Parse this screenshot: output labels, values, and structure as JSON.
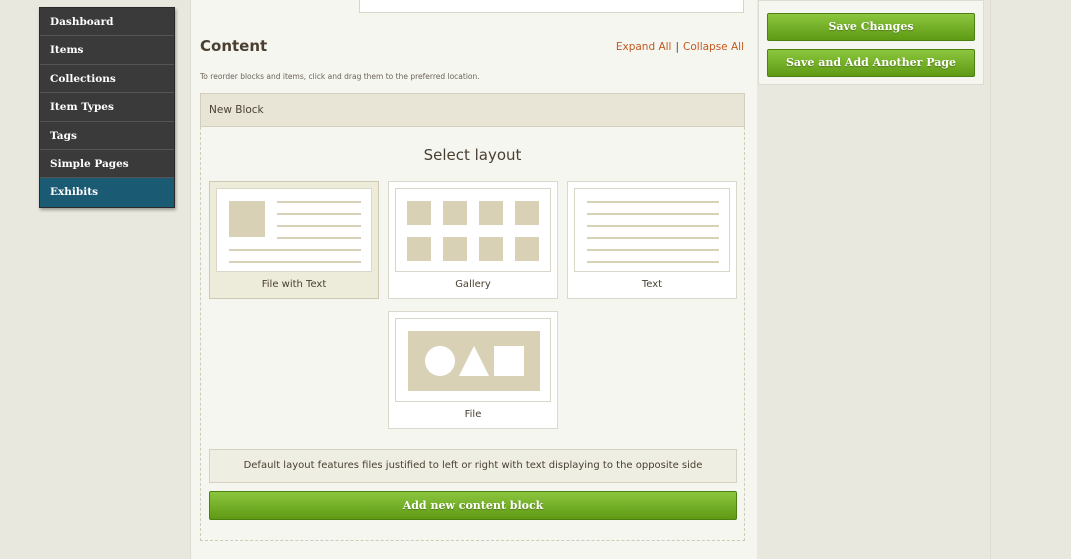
{
  "nav": {
    "items": [
      {
        "label": "Dashboard"
      },
      {
        "label": "Items"
      },
      {
        "label": "Collections"
      },
      {
        "label": "Item Types"
      },
      {
        "label": "Tags"
      },
      {
        "label": "Simple Pages"
      },
      {
        "label": "Exhibits"
      }
    ]
  },
  "content": {
    "title": "Content",
    "expand_all": "Expand All",
    "separator": "|",
    "collapse_all": "Collapse All",
    "reorder_hint": "To reorder blocks and items, click and drag them to the preferred location."
  },
  "block": {
    "header": "New Block",
    "select_layout": "Select layout",
    "layouts": [
      {
        "label": "File with Text",
        "icon": "file-with-text-icon",
        "selected": true
      },
      {
        "label": "Gallery",
        "icon": "gallery-icon",
        "selected": false
      },
      {
        "label": "Text",
        "icon": "text-icon",
        "selected": false
      },
      {
        "label": "File",
        "icon": "file-icon",
        "selected": false
      }
    ],
    "description": "Default layout features files justified to left or right with text displaying to the opposite side",
    "add_button": "Add new content block"
  },
  "save_panel": {
    "save_changes": "Save Changes",
    "save_and_add": "Save and Add Another Page"
  },
  "colors": {
    "accent_green": "#6fab1f",
    "link_orange": "#c2591e",
    "nav_dark": "#3a3a3a",
    "nav_active": "#1b5a73",
    "placeholder_tan": "#d9d1b6"
  }
}
